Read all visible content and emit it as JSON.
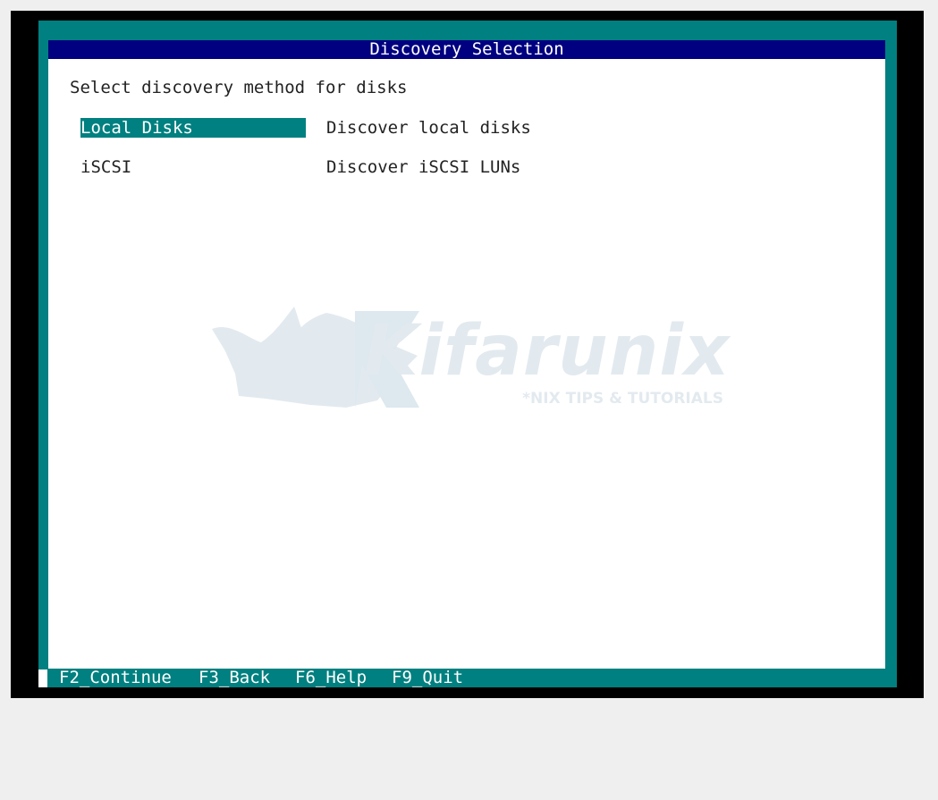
{
  "window": {
    "title": "Discovery Selection"
  },
  "prompt": "Select discovery method for disks",
  "options": [
    {
      "label": "Local Disks",
      "description": "Discover local disks",
      "selected": true
    },
    {
      "label": "iSCSI",
      "description": "Discover iSCSI LUNs",
      "selected": false
    }
  ],
  "watermark": {
    "brand": "Kifarunix",
    "tagline": "*NIX TIPS & TUTORIALS",
    "icon": "rhino-icon"
  },
  "function_keys": [
    {
      "label": "F2_Continue"
    },
    {
      "label": "F3_Back"
    },
    {
      "label": "F6_Help"
    },
    {
      "label": "F9_Quit"
    }
  ],
  "colors": {
    "title_bar": "#000080",
    "accent": "#008080",
    "panel": "#ffffff",
    "screen_bg": "#000000"
  }
}
